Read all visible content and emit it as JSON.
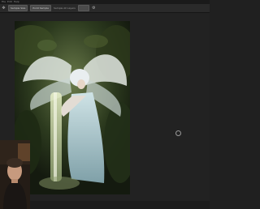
{
  "menubar": {
    "items": [
      "File",
      "Edit",
      "Image",
      "Layer",
      "Type",
      "Select",
      "Filter",
      "3D",
      "View",
      "Window",
      "Help"
    ]
  },
  "options_bar": {
    "tool_icon": "move-tool-icon",
    "chips": [
      "Sample Size",
      "Point Sample"
    ],
    "label": "Sample All Layers",
    "value": "",
    "right_icon": "brush-settings-icon"
  },
  "canvas": {
    "content": "fantasy fairy artwork"
  },
  "colors": {
    "workspace": "#222222",
    "menubar": "#1a1a1a",
    "options_bar": "#2a2a2a"
  }
}
